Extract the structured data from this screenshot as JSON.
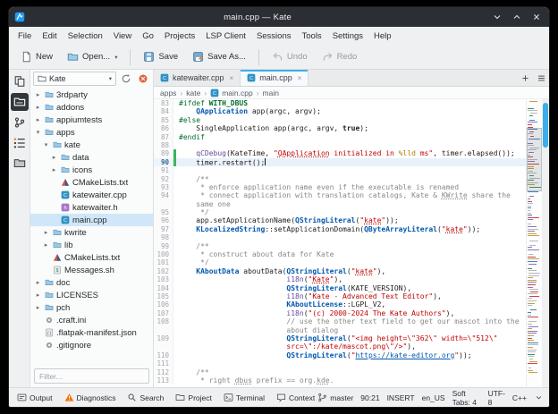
{
  "window": {
    "title": "main.cpp — Kate"
  },
  "menubar": {
    "items": [
      "File",
      "Edit",
      "Selection",
      "View",
      "Go",
      "Projects",
      "LSP Client",
      "Sessions",
      "Tools",
      "Settings",
      "Help"
    ]
  },
  "toolbar": {
    "items": [
      {
        "label": "New",
        "icon": "new-doc-icon"
      },
      {
        "label": "Open...",
        "icon": "open-folder-icon",
        "dropdown": true
      },
      {
        "type": "sep"
      },
      {
        "label": "Save",
        "icon": "save-icon"
      },
      {
        "label": "Save As...",
        "icon": "save-as-icon"
      },
      {
        "type": "sep"
      },
      {
        "label": "Undo",
        "icon": "undo-icon",
        "disabled": true
      },
      {
        "label": "Redo",
        "icon": "redo-icon",
        "disabled": true
      }
    ]
  },
  "sidebar": {
    "buttons": [
      {
        "name": "documents",
        "icon": "documents-icon"
      },
      {
        "name": "projects",
        "icon": "projects-icon",
        "active": true
      },
      {
        "name": "git",
        "icon": "git-icon"
      },
      {
        "name": "symbols",
        "icon": "symbols-icon"
      },
      {
        "name": "filesystem",
        "icon": "filesystem-icon"
      }
    ]
  },
  "projects_panel": {
    "project_name": "Kate",
    "filter_placeholder": "Filter...",
    "tree": [
      {
        "label": "3rdparty",
        "icon": "folder-icon",
        "depth": 0,
        "arrow": "closed"
      },
      {
        "label": "addons",
        "icon": "folder-icon",
        "depth": 0,
        "arrow": "closed"
      },
      {
        "label": "appiumtests",
        "icon": "folder-icon",
        "depth": 0,
        "arrow": "closed"
      },
      {
        "label": "apps",
        "icon": "folder-icon",
        "depth": 0,
        "arrow": "open"
      },
      {
        "label": "kate",
        "icon": "folder-icon",
        "depth": 1,
        "arrow": "open"
      },
      {
        "label": "data",
        "icon": "folder-icon",
        "depth": 2,
        "arrow": "closed"
      },
      {
        "label": "icons",
        "icon": "folder-icon",
        "depth": 2,
        "arrow": "closed"
      },
      {
        "label": "CMakeLists.txt",
        "icon": "cmake-icon",
        "depth": 2
      },
      {
        "label": "katewaiter.cpp",
        "icon": "cpp-icon",
        "depth": 2
      },
      {
        "label": "katewaiter.h",
        "icon": "header-icon",
        "depth": 2
      },
      {
        "label": "main.cpp",
        "icon": "cpp-icon",
        "depth": 2,
        "selected": true
      },
      {
        "label": "kwrite",
        "icon": "folder-icon",
        "depth": 1,
        "arrow": "closed"
      },
      {
        "label": "lib",
        "icon": "folder-icon",
        "depth": 1,
        "arrow": "closed"
      },
      {
        "label": "CMakeLists.txt",
        "icon": "cmake-icon",
        "depth": 1
      },
      {
        "label": "Messages.sh",
        "icon": "script-icon",
        "depth": 1
      },
      {
        "label": "doc",
        "icon": "folder-icon",
        "depth": 0,
        "arrow": "closed"
      },
      {
        "label": "LICENSES",
        "icon": "folder-icon",
        "depth": 0,
        "arrow": "closed"
      },
      {
        "label": "pch",
        "icon": "folder-icon",
        "depth": 0,
        "arrow": "closed"
      },
      {
        "label": ".craft.ini",
        "icon": "config-icon",
        "depth": 0
      },
      {
        "label": ".flatpak-manifest.json",
        "icon": "json-icon",
        "depth": 0
      },
      {
        "label": ".gitignore",
        "icon": "config-icon",
        "depth": 0
      }
    ]
  },
  "editor": {
    "tabs": [
      {
        "label": "katewaiter.cpp",
        "icon": "cpp-icon"
      },
      {
        "label": "main.cpp",
        "icon": "cpp-icon",
        "active": true
      }
    ],
    "tabbar_icons": [
      "plus-icon",
      "menu-icon"
    ],
    "breadcrumb": [
      {
        "label": "apps"
      },
      {
        "label": "kate"
      },
      {
        "label": "main.cpp",
        "icon": "cpp-icon"
      },
      {
        "label": "main"
      }
    ],
    "cursor_position": "90:21",
    "lines": [
      {
        "n": "83",
        "t": [
          [
            "pp",
            "#ifdef "
          ],
          [
            "ppb",
            "WITH_DBUS"
          ]
        ]
      },
      {
        "n": "84",
        "t": [
          [
            "pl",
            "    "
          ],
          [
            "ty",
            "QApplication"
          ],
          [
            "pl",
            " app(argc, argv);"
          ]
        ]
      },
      {
        "n": "85",
        "t": [
          [
            "pp",
            "#else"
          ]
        ]
      },
      {
        "n": "86",
        "t": [
          [
            "pl",
            "    SingleApplication app(argc, argv, "
          ],
          [
            "kw",
            "true"
          ],
          [
            "pl",
            ");"
          ]
        ]
      },
      {
        "n": "87",
        "t": [
          [
            "pp",
            "#endif"
          ]
        ]
      },
      {
        "n": "88",
        "t": []
      },
      {
        "n": "89",
        "mark": true,
        "t": [
          [
            "pl",
            "    "
          ],
          [
            "fn",
            "qCDebug"
          ],
          [
            "pl",
            "(KateTime, "
          ],
          [
            "st",
            "\""
          ],
          [
            "stu",
            "QApplication"
          ],
          [
            "st",
            " initialized in "
          ],
          [
            "sf",
            "%lld"
          ],
          [
            "st",
            " ms\""
          ],
          [
            "pl",
            ", timer.elapsed());"
          ]
        ]
      },
      {
        "n": "90",
        "cur": true,
        "mark": true,
        "t": [
          [
            "pl",
            "    timer.restart();"
          ]
        ]
      },
      {
        "n": "91",
        "t": []
      },
      {
        "n": "92",
        "t": [
          [
            "cm",
            "    /**"
          ]
        ]
      },
      {
        "n": "93",
        "t": [
          [
            "cm",
            "     * enforce application name even if the executable is renamed"
          ]
        ]
      },
      {
        "n": "94",
        "t": [
          [
            "cm",
            "     * connect application with translation catalogs, Kate & "
          ],
          [
            "cmu",
            "KWrite"
          ],
          [
            "cm",
            " share the"
          ]
        ]
      },
      {
        "n": "",
        "t": [
          [
            "cm",
            "    same one"
          ]
        ]
      },
      {
        "n": "95",
        "t": [
          [
            "cm",
            "     */"
          ]
        ]
      },
      {
        "n": "96",
        "t": [
          [
            "pl",
            "    app.setApplicationName("
          ],
          [
            "ty",
            "QStringLiteral"
          ],
          [
            "pl",
            "("
          ],
          [
            "st",
            "\""
          ],
          [
            "stu",
            "kate"
          ],
          [
            "st",
            "\""
          ],
          [
            "pl",
            "));"
          ]
        ]
      },
      {
        "n": "97",
        "t": [
          [
            "pl",
            "    "
          ],
          [
            "ty",
            "KLocalizedString"
          ],
          [
            "pl",
            "::setApplicationDomain("
          ],
          [
            "ty",
            "QByteArrayLiteral"
          ],
          [
            "pl",
            "("
          ],
          [
            "st",
            "\""
          ],
          [
            "stu",
            "kate"
          ],
          [
            "st",
            "\""
          ],
          [
            "pl",
            "));"
          ]
        ]
      },
      {
        "n": "98",
        "t": []
      },
      {
        "n": "99",
        "t": [
          [
            "cm",
            "    /**"
          ]
        ]
      },
      {
        "n": "100",
        "t": [
          [
            "cm",
            "     * construct about data for Kate"
          ]
        ]
      },
      {
        "n": "101",
        "t": [
          [
            "cm",
            "     */"
          ]
        ]
      },
      {
        "n": "102",
        "t": [
          [
            "pl",
            "    "
          ],
          [
            "ty",
            "KAboutData"
          ],
          [
            "pl",
            " aboutData("
          ],
          [
            "ty",
            "QStringLiteral"
          ],
          [
            "pl",
            "("
          ],
          [
            "st",
            "\""
          ],
          [
            "stu",
            "kate"
          ],
          [
            "st",
            "\""
          ],
          [
            "pl",
            "),"
          ]
        ]
      },
      {
        "n": "103",
        "t": [
          [
            "pl",
            "                         "
          ],
          [
            "fn",
            "i18n"
          ],
          [
            "pl",
            "("
          ],
          [
            "st",
            "\""
          ],
          [
            "stu",
            "Kate"
          ],
          [
            "st",
            "\""
          ],
          [
            "pl",
            "),"
          ]
        ]
      },
      {
        "n": "104",
        "t": [
          [
            "pl",
            "                         "
          ],
          [
            "ty",
            "QStringLiteral"
          ],
          [
            "pl",
            "(KATE_VERSION),"
          ]
        ]
      },
      {
        "n": "105",
        "t": [
          [
            "pl",
            "                         "
          ],
          [
            "fn",
            "i18n"
          ],
          [
            "pl",
            "("
          ],
          [
            "st",
            "\"Kate - Advanced Text Editor\""
          ],
          [
            "pl",
            "),"
          ]
        ]
      },
      {
        "n": "106",
        "t": [
          [
            "pl",
            "                         "
          ],
          [
            "ty",
            "KAboutLicense"
          ],
          [
            "pl",
            "::LGPL_V2,"
          ]
        ]
      },
      {
        "n": "107",
        "t": [
          [
            "pl",
            "                         "
          ],
          [
            "fn",
            "i18n"
          ],
          [
            "pl",
            "("
          ],
          [
            "st",
            "\"(c) 2000-2024 The Kate Authors\""
          ],
          [
            "pl",
            "),"
          ]
        ]
      },
      {
        "n": "108",
        "t": [
          [
            "pl",
            "                         "
          ],
          [
            "cm",
            "// use the other text field to get our mascot into the"
          ]
        ]
      },
      {
        "n": "",
        "t": [
          [
            "cm",
            "                         about dialog"
          ]
        ]
      },
      {
        "n": "109",
        "t": [
          [
            "pl",
            "                         "
          ],
          [
            "ty",
            "QStringLiteral"
          ],
          [
            "pl",
            "("
          ],
          [
            "st",
            "\"<img height=\\\"362\\\" width=\\\"512\\\""
          ]
        ]
      },
      {
        "n": "",
        "t": [
          [
            "st",
            "                         src=\\\":/kate/mascot.png\\\"/>\""
          ],
          [
            "pl",
            "),"
          ]
        ]
      },
      {
        "n": "110",
        "t": [
          [
            "pl",
            "                         "
          ],
          [
            "ty",
            "QStringLiteral"
          ],
          [
            "pl",
            "("
          ],
          [
            "st",
            "\""
          ],
          [
            "ln",
            "https://kate-editor.org"
          ],
          [
            "st",
            "\""
          ],
          [
            "pl",
            "));"
          ]
        ]
      },
      {
        "n": "111",
        "t": []
      },
      {
        "n": "112",
        "t": [
          [
            "cm",
            "    /**"
          ]
        ]
      },
      {
        "n": "113",
        "t": [
          [
            "cm",
            "     * right "
          ],
          [
            "cmu",
            "dbus"
          ],
          [
            "cm",
            " prefix == org."
          ],
          [
            "cmu",
            "kde"
          ],
          [
            "cm",
            "."
          ]
        ]
      }
    ]
  },
  "statusbar": {
    "left": [
      {
        "label": "Output",
        "icon": "output-icon"
      },
      {
        "label": "Diagnostics",
        "icon": "warning-icon"
      },
      {
        "label": "Search",
        "icon": "search-icon"
      },
      {
        "label": "Project",
        "icon": "project-icon"
      },
      {
        "label": "Terminal",
        "icon": "terminal-icon"
      },
      {
        "label": "Context",
        "icon": "context-icon"
      }
    ],
    "right": [
      {
        "label": "master",
        "icon": "branch-icon"
      },
      {
        "label": "90:21"
      },
      {
        "label": "INSERT"
      },
      {
        "label": "en_US"
      },
      {
        "label": "Soft Tabs: 4"
      },
      {
        "label": "UTF-8"
      },
      {
        "label": "C++"
      },
      {
        "icon": "chevron-down-icon"
      }
    ]
  },
  "colors": {
    "accent": "#3daee9",
    "titlebar": "#2b2e33",
    "preprocessor": "#006e28",
    "type": "#0057ae",
    "string": "#bf0303",
    "comment": "#898887",
    "function": "#644a9b",
    "warning": "#f67400"
  }
}
